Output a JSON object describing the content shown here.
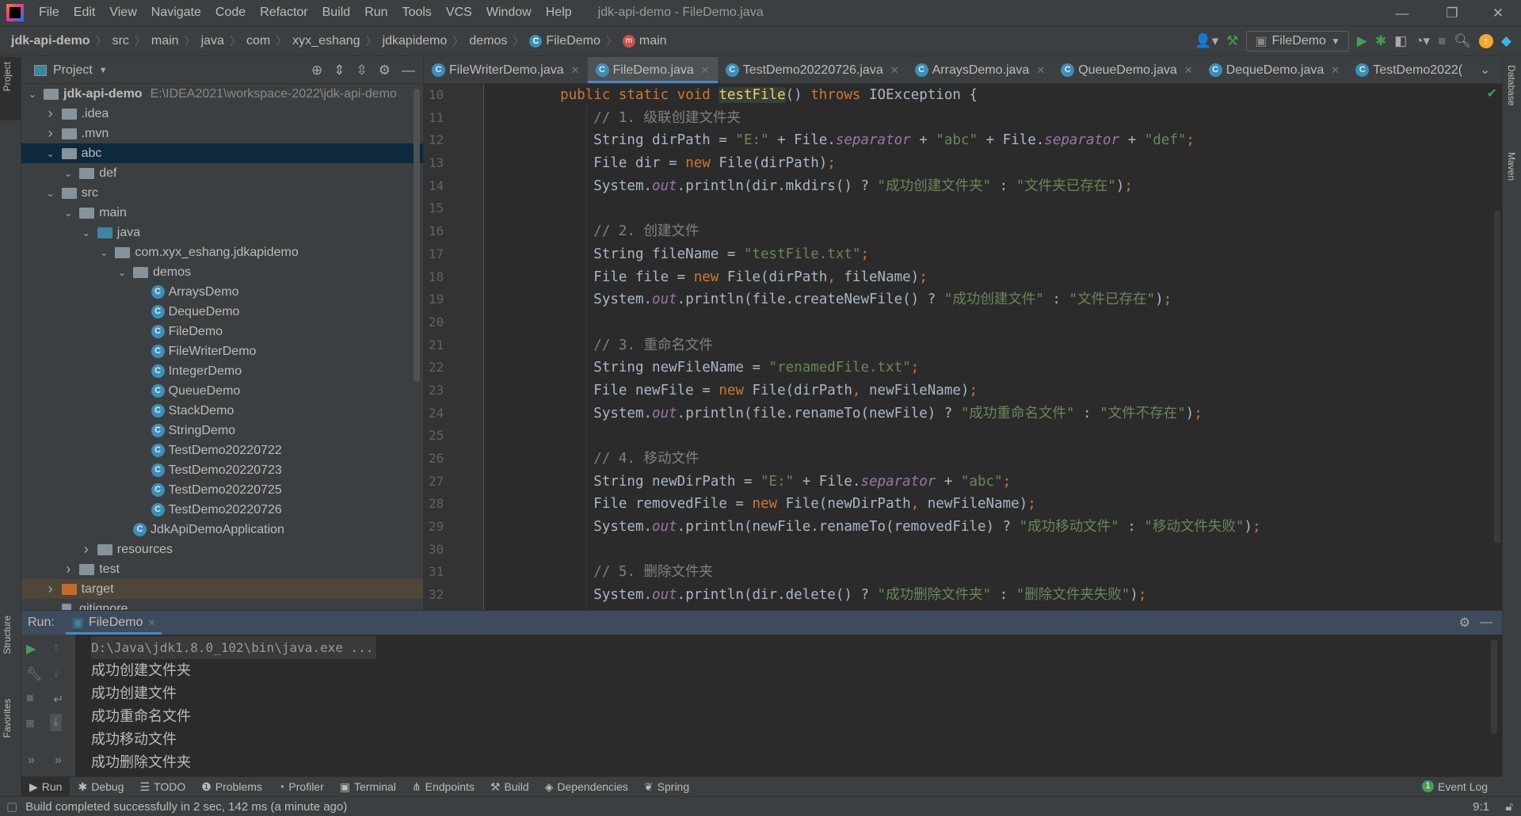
{
  "menu": {
    "items": [
      "File",
      "Edit",
      "View",
      "Navigate",
      "Code",
      "Refactor",
      "Build",
      "Run",
      "Tools",
      "VCS",
      "Window",
      "Help"
    ],
    "title": "jdk-api-demo - FileDemo.java"
  },
  "breadcrumb": {
    "items": [
      "jdk-api-demo",
      "src",
      "main",
      "java",
      "com",
      "xyx_eshang",
      "jdkapidemo",
      "demos",
      "FileDemo",
      "main"
    ]
  },
  "toolbar": {
    "run_config": "FileDemo"
  },
  "project": {
    "title": "Project",
    "root_path": "E:\\IDEA2021\\workspace-2022\\jdk-api-demo",
    "items": [
      {
        "label": "jdk-api-demo",
        "level": 0,
        "chev": "down",
        "icon": "module"
      },
      {
        "label": ".idea",
        "level": 1,
        "chev": "right",
        "icon": "folder"
      },
      {
        "label": ".mvn",
        "level": 1,
        "chev": "right",
        "icon": "folder"
      },
      {
        "label": "abc",
        "level": 1,
        "chev": "down",
        "icon": "folder",
        "selected": true
      },
      {
        "label": "def",
        "level": 2,
        "chev": "down",
        "icon": "folder"
      },
      {
        "label": "src",
        "level": 1,
        "chev": "down",
        "icon": "folder"
      },
      {
        "label": "main",
        "level": 2,
        "chev": "down",
        "icon": "folder"
      },
      {
        "label": "java",
        "level": 3,
        "chev": "down",
        "icon": "source-folder"
      },
      {
        "label": "com.xyx_eshang.jdkapidemo",
        "level": 4,
        "chev": "down",
        "icon": "package"
      },
      {
        "label": "demos",
        "level": 5,
        "chev": "down",
        "icon": "package"
      },
      {
        "label": "ArraysDemo",
        "level": 6,
        "icon": "class"
      },
      {
        "label": "DequeDemo",
        "level": 6,
        "icon": "class"
      },
      {
        "label": "FileDemo",
        "level": 6,
        "icon": "class"
      },
      {
        "label": "FileWriterDemo",
        "level": 6,
        "icon": "class"
      },
      {
        "label": "IntegerDemo",
        "level": 6,
        "icon": "class"
      },
      {
        "label": "QueueDemo",
        "level": 6,
        "icon": "class"
      },
      {
        "label": "StackDemo",
        "level": 6,
        "icon": "class"
      },
      {
        "label": "StringDemo",
        "level": 6,
        "icon": "class"
      },
      {
        "label": "TestDemo20220722",
        "level": 6,
        "icon": "class"
      },
      {
        "label": "TestDemo20220723",
        "level": 6,
        "icon": "class"
      },
      {
        "label": "TestDemo20220725",
        "level": 6,
        "icon": "class"
      },
      {
        "label": "TestDemo20220726",
        "level": 6,
        "icon": "class"
      },
      {
        "label": "JdkApiDemoApplication",
        "level": 5,
        "icon": "spring-class"
      },
      {
        "label": "resources",
        "level": 3,
        "chev": "right",
        "icon": "resources-folder"
      },
      {
        "label": "test",
        "level": 2,
        "chev": "right",
        "icon": "folder"
      },
      {
        "label": "target",
        "level": 1,
        "chev": "right",
        "icon": "excluded-folder",
        "target": true
      },
      {
        "label": ".gitignore",
        "level": 1,
        "icon": "file"
      }
    ]
  },
  "tabs": [
    {
      "label": "FileWriterDemo.java"
    },
    {
      "label": "FileDemo.java",
      "active": true
    },
    {
      "label": "TestDemo20220726.java"
    },
    {
      "label": "ArraysDemo.java"
    },
    {
      "label": "QueueDemo.java"
    },
    {
      "label": "DequeDemo.java"
    },
    {
      "label": "TestDemo2022("
    }
  ],
  "editor": {
    "first_line": 10,
    "lines": [
      [
        [
          "p",
          "    "
        ],
        [
          "kw",
          "public static void "
        ],
        [
          "md",
          "testFile"
        ],
        [
          "p",
          "() "
        ],
        [
          "kw",
          "throws "
        ],
        [
          "p",
          "IOException {"
        ]
      ],
      [
        [
          "p",
          "        "
        ],
        [
          "cm",
          "// 1. 级联创建文件夹"
        ]
      ],
      [
        [
          "p",
          "        String dirPath = "
        ],
        [
          "str",
          "\"E:\""
        ],
        [
          "p",
          " + File."
        ],
        [
          "sf",
          "separator"
        ],
        [
          "p",
          " + "
        ],
        [
          "str",
          "\"abc\""
        ],
        [
          "p",
          " + File."
        ],
        [
          "sf",
          "separator"
        ],
        [
          "p",
          " + "
        ],
        [
          "str",
          "\"def\""
        ],
        [
          "kw",
          ";"
        ]
      ],
      [
        [
          "p",
          "        File dir = "
        ],
        [
          "kw",
          "new "
        ],
        [
          "p",
          "File(dirPath)"
        ],
        [
          "kw",
          ";"
        ]
      ],
      [
        [
          "p",
          "        System."
        ],
        [
          "sf",
          "out"
        ],
        [
          "p",
          ".println(dir.mkdirs() ? "
        ],
        [
          "str",
          "\"成功创建文件夹\""
        ],
        [
          "p",
          " : "
        ],
        [
          "str",
          "\"文件夹已存在\""
        ],
        [
          "p",
          ")"
        ],
        [
          "kw",
          ";"
        ]
      ],
      [],
      [
        [
          "p",
          "        "
        ],
        [
          "cm",
          "// 2. 创建文件"
        ]
      ],
      [
        [
          "p",
          "        String fileName = "
        ],
        [
          "str",
          "\"testFile.txt\""
        ],
        [
          "kw",
          ";"
        ]
      ],
      [
        [
          "p",
          "        File file = "
        ],
        [
          "kw",
          "new "
        ],
        [
          "p",
          "File(dirPath"
        ],
        [
          "kw",
          ", "
        ],
        [
          "p",
          "fileName)"
        ],
        [
          "kw",
          ";"
        ]
      ],
      [
        [
          "p",
          "        System."
        ],
        [
          "sf",
          "out"
        ],
        [
          "p",
          ".println(file.createNewFile() ? "
        ],
        [
          "str",
          "\"成功创建文件\""
        ],
        [
          "p",
          " : "
        ],
        [
          "str",
          "\"文件已存在\""
        ],
        [
          "p",
          ")"
        ],
        [
          "kw",
          ";"
        ]
      ],
      [],
      [
        [
          "p",
          "        "
        ],
        [
          "cm",
          "// 3. 重命名文件"
        ]
      ],
      [
        [
          "p",
          "        String newFileName = "
        ],
        [
          "str",
          "\"renamedFile.txt\""
        ],
        [
          "kw",
          ";"
        ]
      ],
      [
        [
          "p",
          "        File newFile = "
        ],
        [
          "kw",
          "new "
        ],
        [
          "p",
          "File(dirPath"
        ],
        [
          "kw",
          ", "
        ],
        [
          "p",
          "newFileName)"
        ],
        [
          "kw",
          ";"
        ]
      ],
      [
        [
          "p",
          "        System."
        ],
        [
          "sf",
          "out"
        ],
        [
          "p",
          ".println(file.renameTo(newFile) ? "
        ],
        [
          "str",
          "\"成功重命名文件\""
        ],
        [
          "p",
          " : "
        ],
        [
          "str",
          "\"文件不存在\""
        ],
        [
          "p",
          ")"
        ],
        [
          "kw",
          ";"
        ]
      ],
      [],
      [
        [
          "p",
          "        "
        ],
        [
          "cm",
          "// 4. 移动文件"
        ]
      ],
      [
        [
          "p",
          "        String newDirPath = "
        ],
        [
          "str",
          "\"E:\""
        ],
        [
          "p",
          " + File."
        ],
        [
          "sf",
          "separator"
        ],
        [
          "p",
          " + "
        ],
        [
          "str",
          "\"abc\""
        ],
        [
          "kw",
          ";"
        ]
      ],
      [
        [
          "p",
          "        File removedFile = "
        ],
        [
          "kw",
          "new "
        ],
        [
          "p",
          "File(newDirPath"
        ],
        [
          "kw",
          ", "
        ],
        [
          "p",
          "newFileName)"
        ],
        [
          "kw",
          ";"
        ]
      ],
      [
        [
          "p",
          "        System."
        ],
        [
          "sf",
          "out"
        ],
        [
          "p",
          ".println(newFile.renameTo(removedFile) ? "
        ],
        [
          "str",
          "\"成功移动文件\""
        ],
        [
          "p",
          " : "
        ],
        [
          "str",
          "\"移动文件失败\""
        ],
        [
          "p",
          ")"
        ],
        [
          "kw",
          ";"
        ]
      ],
      [],
      [
        [
          "p",
          "        "
        ],
        [
          "cm",
          "// 5. 删除文件夹"
        ]
      ],
      [
        [
          "p",
          "        System."
        ],
        [
          "sf",
          "out"
        ],
        [
          "p",
          ".println(dir.delete() ? "
        ],
        [
          "str",
          "\"成功删除文件夹\""
        ],
        [
          "p",
          " : "
        ],
        [
          "str",
          "\"删除文件夹失败\""
        ],
        [
          "p",
          ")"
        ],
        [
          "kw",
          ";"
        ]
      ]
    ]
  },
  "run": {
    "label": "Run:",
    "tab": "FileDemo",
    "console": [
      "D:\\Java\\jdk1.8.0_102\\bin\\java.exe ...",
      "成功创建文件夹",
      "成功创建文件",
      "成功重命名文件",
      "成功移动文件",
      "成功删除文件夹"
    ]
  },
  "left_strip": {
    "project": "Project",
    "structure": "Structure",
    "favorites": "Favorites"
  },
  "right_strip": {
    "database": "Database",
    "maven": "Maven"
  },
  "bottom_tools": [
    {
      "label": "Run",
      "icon": "play-icon",
      "glyph": "▶"
    },
    {
      "label": "Debug",
      "icon": "bug-icon",
      "glyph": "✱"
    },
    {
      "label": "TODO",
      "icon": "list-icon",
      "glyph": "☰"
    },
    {
      "label": "Problems",
      "icon": "info-icon",
      "glyph": "❶"
    },
    {
      "label": "Profiler",
      "icon": "profiler-icon",
      "glyph": "◔"
    },
    {
      "label": "Terminal",
      "icon": "terminal-icon",
      "glyph": "▣"
    },
    {
      "label": "Endpoints",
      "icon": "endpoints-icon",
      "glyph": "⋔"
    },
    {
      "label": "Build",
      "icon": "hammer-icon",
      "glyph": "⚒"
    },
    {
      "label": "Dependencies",
      "icon": "dependencies-icon",
      "glyph": "◈"
    },
    {
      "label": "Spring",
      "icon": "spring-icon",
      "glyph": "❦"
    }
  ],
  "event_log": {
    "label": "Event Log",
    "count": "1"
  },
  "status": {
    "message": "Build completed successfully in 2 sec, 142 ms (a minute ago)",
    "position": "9:1"
  },
  "colors": {
    "accent": "#4a88c7",
    "keyword": "#cc7832",
    "string": "#6a8759",
    "comment": "#808080",
    "field": "#9876aa",
    "selection": "#0d293e"
  }
}
